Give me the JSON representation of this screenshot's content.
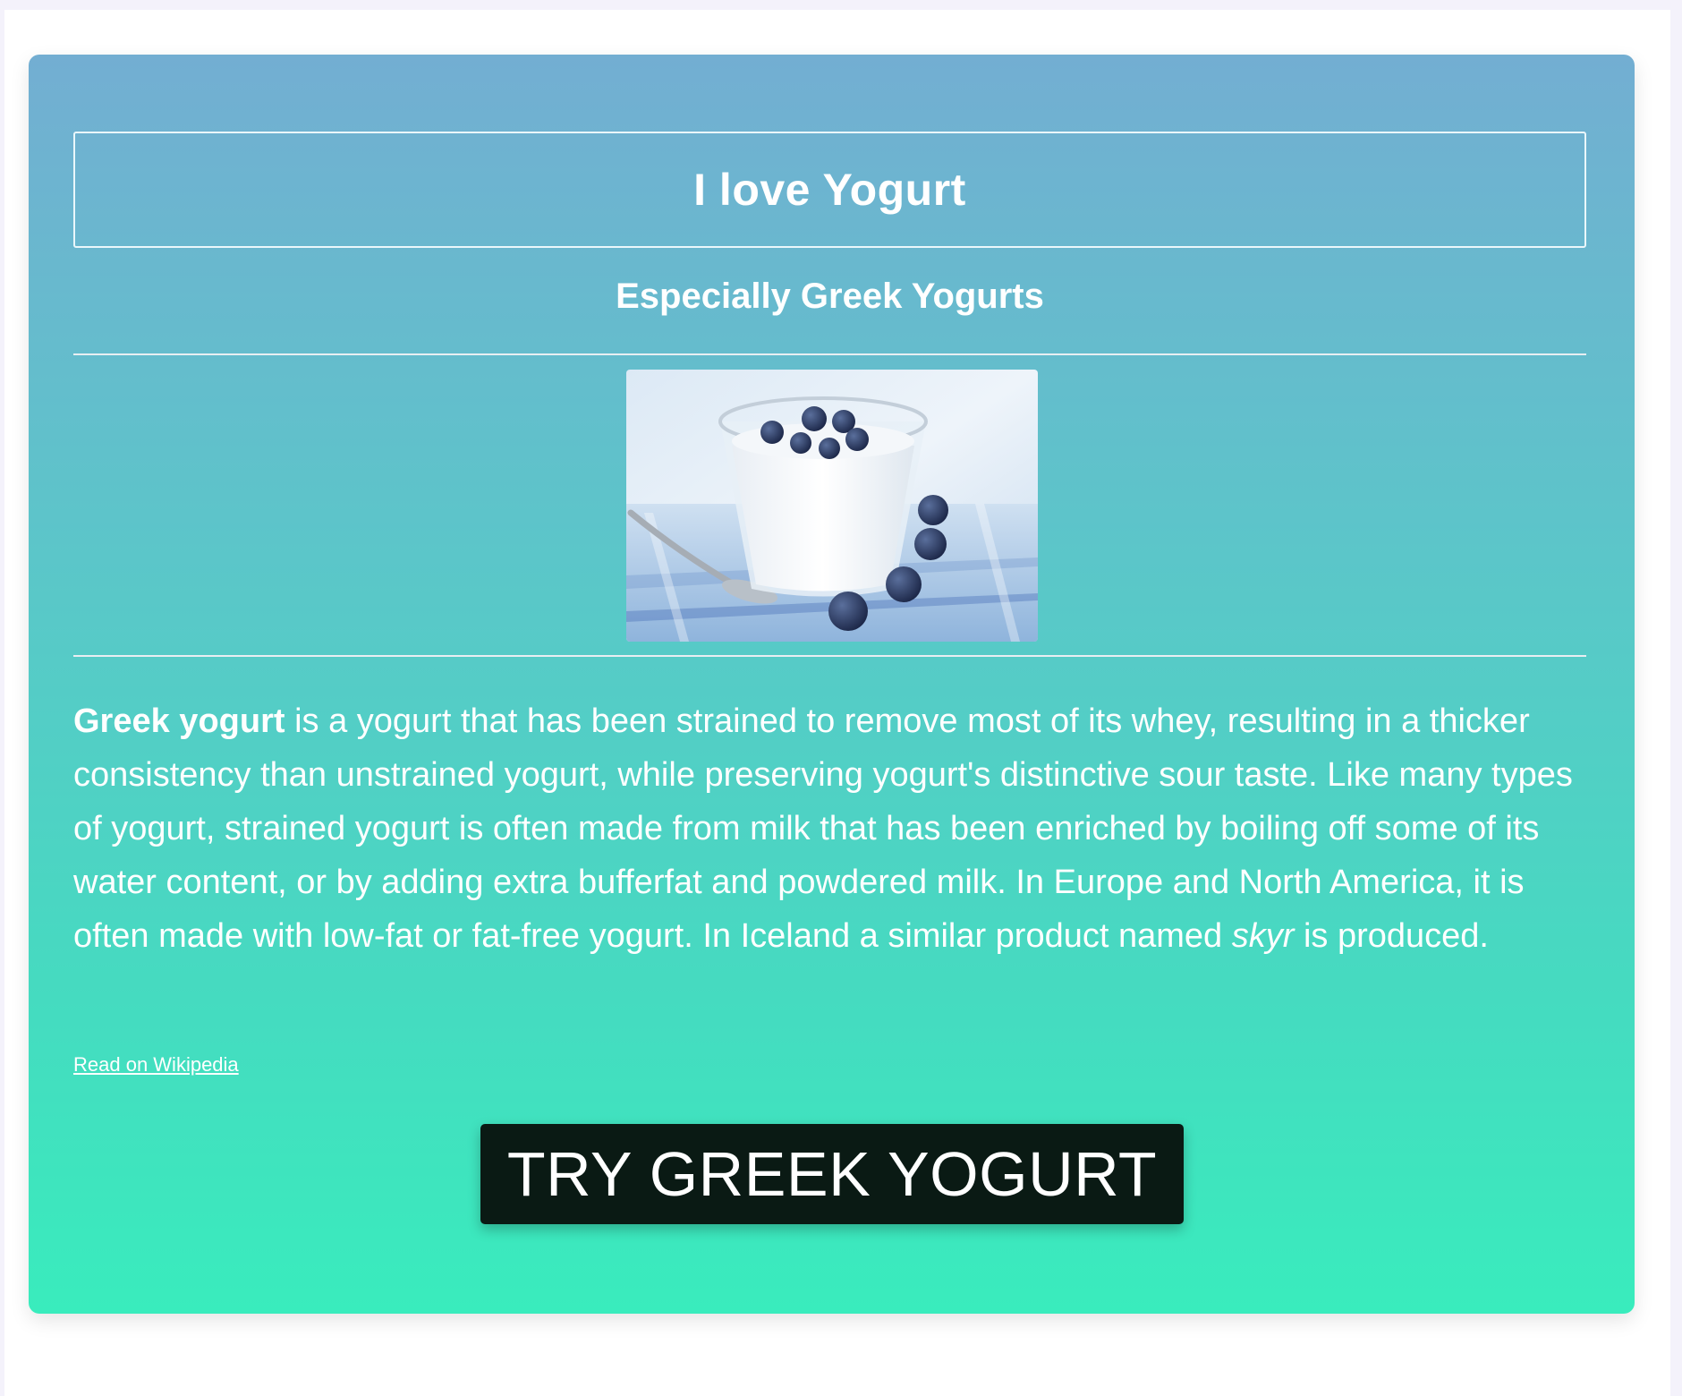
{
  "header": {
    "title": "I love Yogurt",
    "subtitle": "Especially Greek Yogurts"
  },
  "image": {
    "subject": "glass of greek yogurt with blueberries and a spoon"
  },
  "article": {
    "term": "Greek yogurt",
    "part1": " is a yogurt that has been strained to remove most of its whey, resulting in a thicker consistency than unstrained yogurt, while preserving yogurt's distinctive sour taste. Like many types of yogurt, strained yogurt is often made from milk that has been enriched by boiling off some of its water content, or by adding extra bufferfat and powdered milk. In Europe and North America, it is often made with low-fat or fat-free yogurt. In Iceland a similar product named ",
    "term2": "skyr",
    "part2": " is produced."
  },
  "link": {
    "label": "Read on Wikipedia"
  },
  "cta": {
    "label": "TRY GREEK YOGURT"
  },
  "colors": {
    "gradient_top": "#73aed2",
    "gradient_bottom": "#39ecbd",
    "button_bg": "#0a1a14",
    "text": "#ffffff"
  }
}
